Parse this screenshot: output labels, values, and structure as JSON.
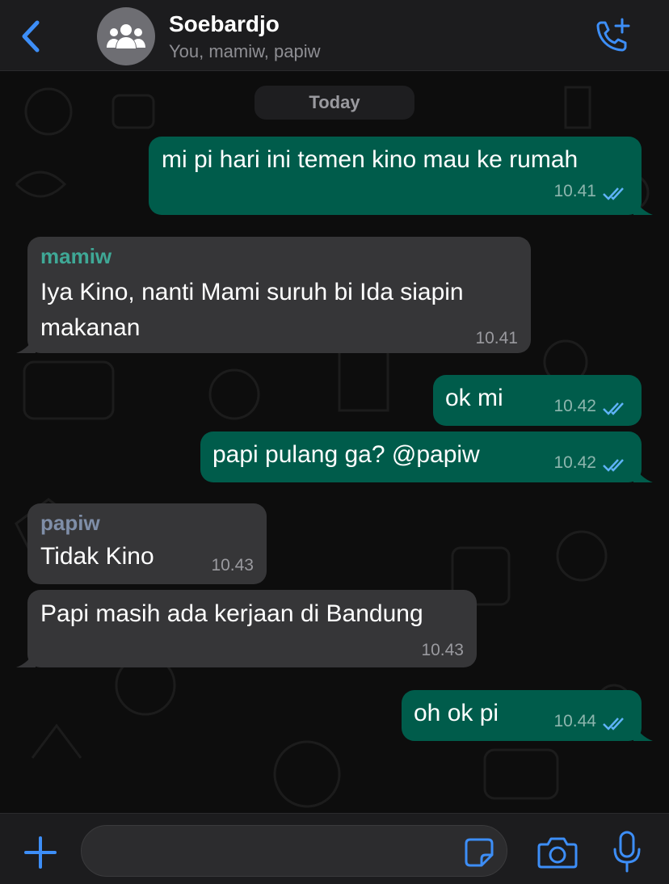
{
  "colors": {
    "accent": "#3d8ef7",
    "outgoing_bubble": "#005c4b",
    "incoming_bubble": "#363638",
    "read_tick": "#5fb3f9",
    "sender_mamiw": "#3fa896",
    "sender_papiw": "#7f8ea8"
  },
  "header": {
    "back_icon": "chevron-left-icon",
    "avatar_icon": "group-icon",
    "title": "Soebardjo",
    "subtitle": "You, mamiw, papiw",
    "call_icon": "add-call-icon"
  },
  "chat": {
    "date_label": "Today",
    "messages": [
      {
        "direction": "out",
        "text": "mi pi hari ini temen kino mau ke rumah",
        "time": "10.41",
        "status": "read"
      },
      {
        "direction": "in",
        "sender": "mamiw",
        "text_lines": [
          "Iya Kino, nanti Mami suruh bi Ida siapin",
          "makanan"
        ],
        "time": "10.41"
      },
      {
        "direction": "out",
        "text": "ok mi",
        "time": "10.42",
        "status": "read"
      },
      {
        "direction": "out",
        "text": "papi pulang ga? @papiw",
        "time": "10.42",
        "status": "read"
      },
      {
        "direction": "in",
        "sender": "papiw",
        "text": "Tidak Kino",
        "time": "10.43"
      },
      {
        "direction": "in",
        "text": "Papi masih ada kerjaan di Bandung",
        "time": "10.43"
      },
      {
        "direction": "out",
        "text": "oh ok pi",
        "time": "10.44",
        "status": "read"
      }
    ]
  },
  "composer": {
    "plus_icon": "plus-icon",
    "input_value": "",
    "sticker_icon": "sticker-icon",
    "camera_icon": "camera-icon",
    "mic_icon": "microphone-icon"
  }
}
